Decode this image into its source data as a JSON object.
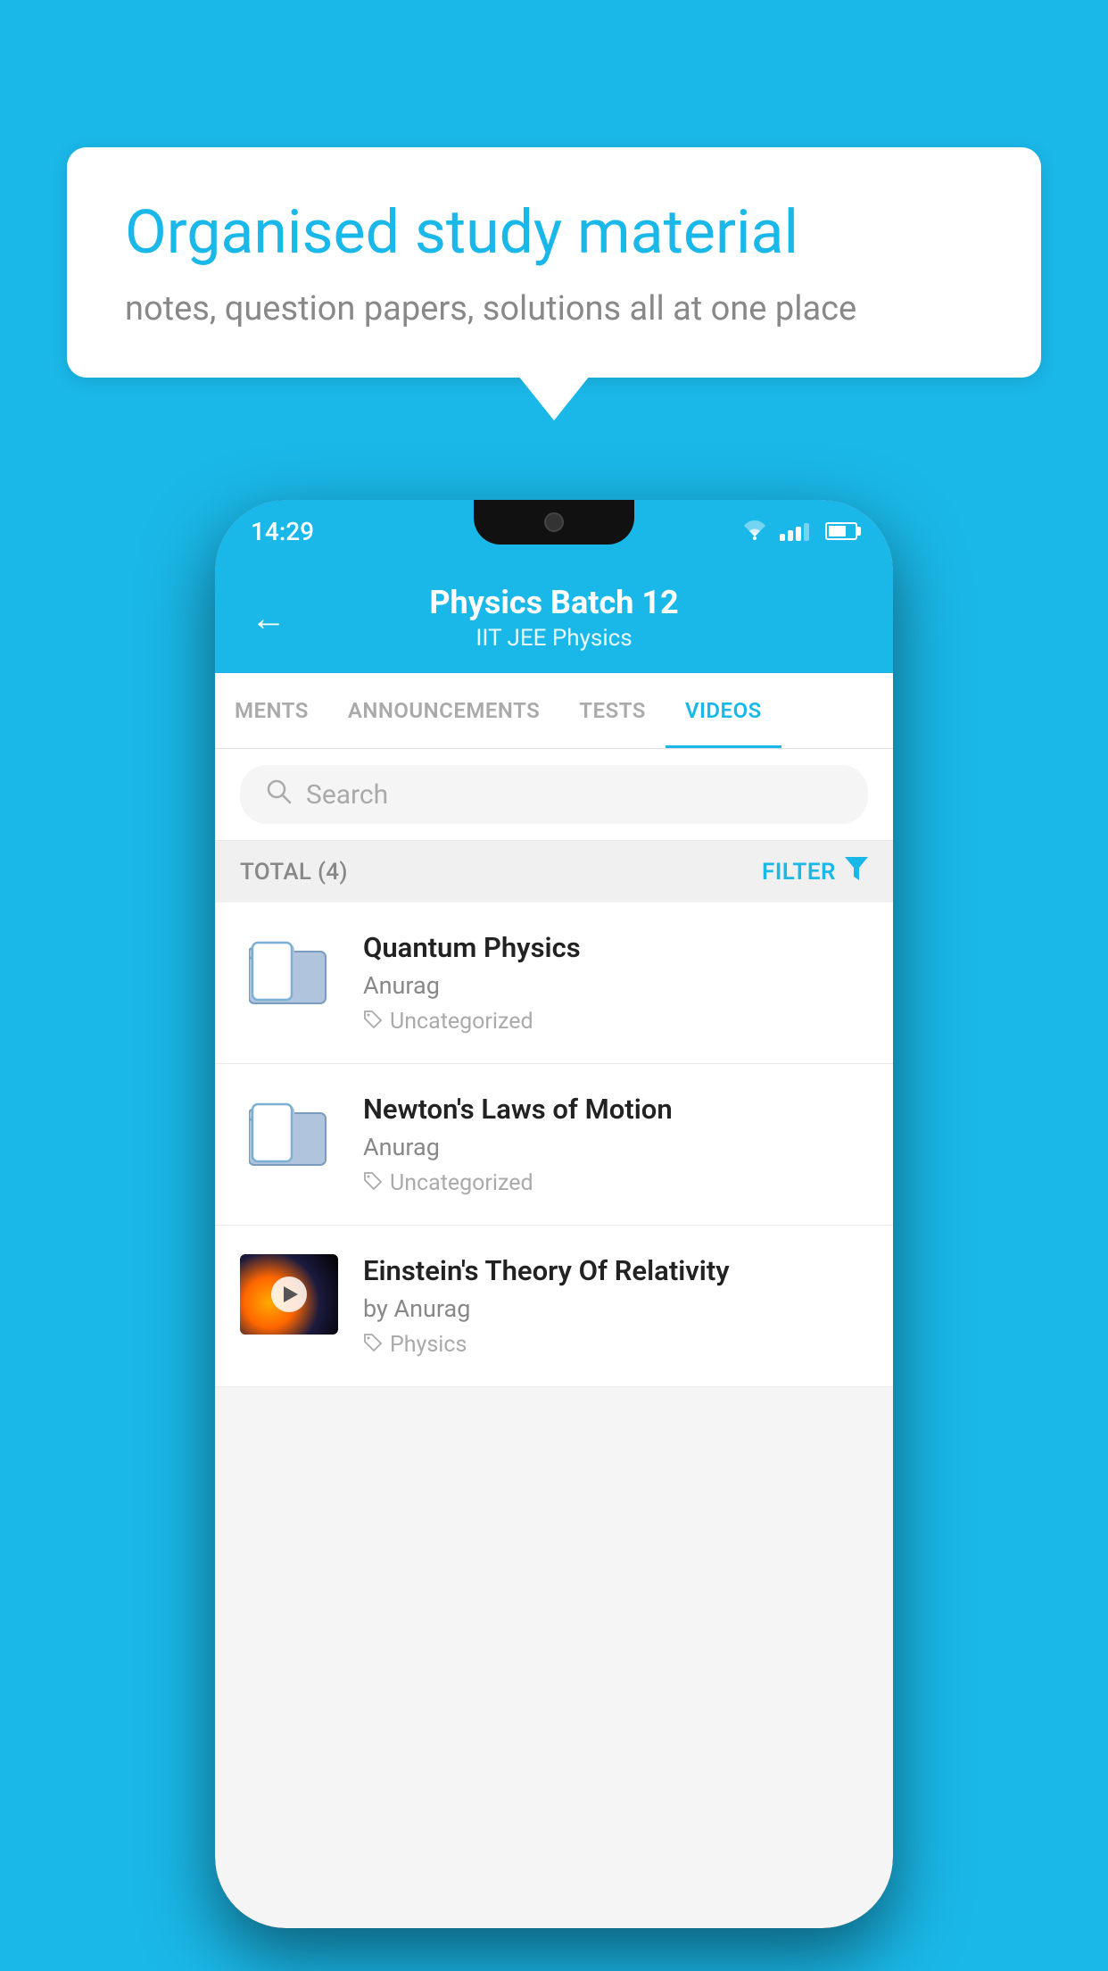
{
  "background_color": "#1ab8e8",
  "speech_bubble": {
    "title": "Organised study material",
    "subtitle": "notes, question papers, solutions all at one place"
  },
  "phone": {
    "status_bar": {
      "time": "14:29"
    },
    "app_header": {
      "title": "Physics Batch 12",
      "subtitle": "IIT JEE   Physics",
      "back_label": "←"
    },
    "tabs": [
      {
        "label": "MENTS",
        "active": false
      },
      {
        "label": "ANNOUNCEMENTS",
        "active": false
      },
      {
        "label": "TESTS",
        "active": false
      },
      {
        "label": "VIDEOS",
        "active": true
      }
    ],
    "search": {
      "placeholder": "Search"
    },
    "filter_row": {
      "total_label": "TOTAL (4)",
      "filter_label": "FILTER"
    },
    "videos": [
      {
        "title": "Quantum Physics",
        "author": "Anurag",
        "tag": "Uncategorized",
        "has_thumb": false
      },
      {
        "title": "Newton's Laws of Motion",
        "author": "Anurag",
        "tag": "Uncategorized",
        "has_thumb": false
      },
      {
        "title": "Einstein's Theory Of Relativity",
        "author": "by Anurag",
        "tag": "Physics",
        "has_thumb": true
      }
    ]
  }
}
